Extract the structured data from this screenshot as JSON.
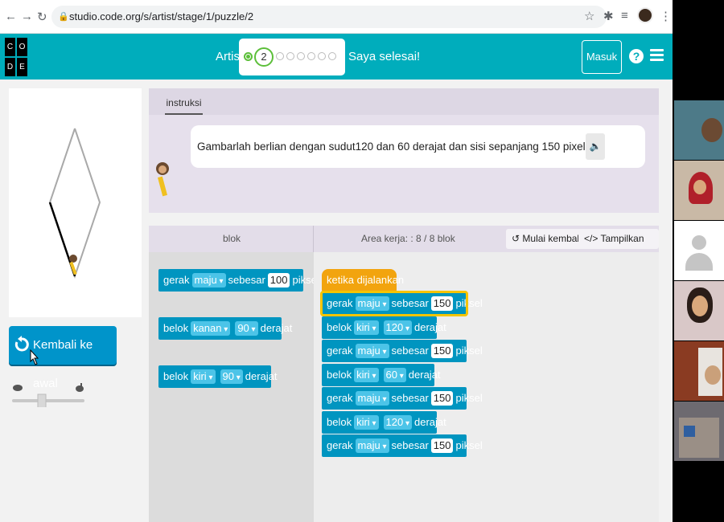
{
  "browser": {
    "url": "studio.code.org/s/artist/stage/1/puzzle/2"
  },
  "header": {
    "logo_letters": [
      "C",
      "O",
      "D",
      "E"
    ],
    "level_title": "Artis",
    "current_puzzle": "2",
    "finish_label": "Saya selesai!",
    "signin_label": "Masuk",
    "help_label": "?"
  },
  "instructions": {
    "tab_label": "instruksi",
    "text": "Gambarlah berlian dengan sudut120 dan 60 derajat dan sisi sepanjang 150 pixel."
  },
  "left": {
    "reset_label": "Kembali ke awal"
  },
  "workspace_header": {
    "toolbox_label": "blok",
    "workspace_label": "Area kerja: : 8 / 8 blok",
    "restart_label": "Mulai kembali",
    "show_code_label": "Tampilkan kode"
  },
  "toolbox_blocks": [
    {
      "verb": "gerak",
      "dir": "maju",
      "mid": "sebesar",
      "value": "100",
      "unit": "piksel"
    },
    {
      "verb": "belok",
      "dir": "kanan",
      "mid": "",
      "value": "90",
      "unit": "derajat"
    },
    {
      "verb": "belok",
      "dir": "kiri",
      "mid": "",
      "value": "90",
      "unit": "derajat"
    }
  ],
  "program": {
    "event_label": "ketika dijalankan",
    "blocks": [
      {
        "verb": "gerak",
        "dir": "maju",
        "mid": "sebesar",
        "value": "150",
        "unit": "piksel"
      },
      {
        "verb": "belok",
        "dir": "kiri",
        "mid": "",
        "value": "120",
        "unit": "derajat"
      },
      {
        "verb": "gerak",
        "dir": "maju",
        "mid": "sebesar",
        "value": "150",
        "unit": "piksel"
      },
      {
        "verb": "belok",
        "dir": "kiri",
        "mid": "",
        "value": "60",
        "unit": "derajat"
      },
      {
        "verb": "gerak",
        "dir": "maju",
        "mid": "sebesar",
        "value": "150",
        "unit": "piksel"
      },
      {
        "verb": "belok",
        "dir": "kiri",
        "mid": "",
        "value": "120",
        "unit": "derajat"
      },
      {
        "verb": "gerak",
        "dir": "maju",
        "mid": "sebesar",
        "value": "150",
        "unit": "piksel"
      }
    ]
  }
}
